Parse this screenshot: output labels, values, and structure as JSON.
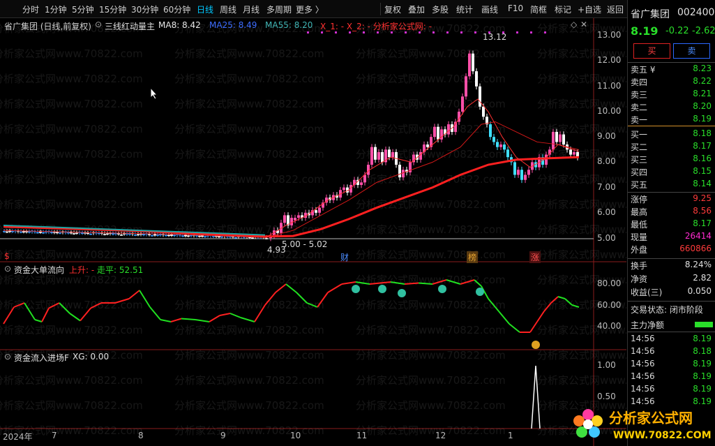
{
  "toolbar": {
    "periods": [
      "分时",
      "1分钟",
      "5分钟",
      "15分钟",
      "30分钟",
      "60分钟",
      "日线",
      "周线",
      "月线",
      "多周期",
      "更多 〉"
    ],
    "active": "日线",
    "tools": [
      "复权",
      "叠加",
      "多股",
      "统计",
      "画线",
      "F10",
      "简框",
      "标记",
      "+自选",
      "返回"
    ]
  },
  "main_chart": {
    "title": "省广集团 (日线,前复权)",
    "indicator": "三线红动量主",
    "ma8": "MA8: 8.42",
    "ma25": "MA25: 8.49",
    "ma55": "MA55: 8.20",
    "x_items": "X_1: -  X_2: -  分析家公式网: -",
    "high_label": "13.12",
    "low_label": "4.93",
    "range_label": "5.00 - 5.02",
    "markers": [
      "$",
      "财",
      "榜",
      "涨"
    ],
    "y_ticks": [
      "13.00",
      "12.00",
      "11.00",
      "10.00",
      "9.00",
      "8.00",
      "7.00",
      "6.00",
      "5.00"
    ]
  },
  "sub1": {
    "title": "资金大单流向",
    "up_label": "上升: -",
    "flat_label": "走平: 52.51",
    "y_ticks": [
      "80.00",
      "60.00",
      "40.00"
    ]
  },
  "sub2": {
    "title": "资金流入进场F",
    "xg": "XG: 0.00",
    "y_ticks": [
      "1.00",
      "0.50"
    ]
  },
  "x_axis": [
    "2024年",
    "7",
    "8",
    "9",
    "10",
    "11",
    "12",
    "1"
  ],
  "watermark": "分析家公式网www.70822.com",
  "right_panel": {
    "name": "省广集团",
    "code": "002400",
    "price": "8.19",
    "change": "-0.22",
    "pct": "-2.62",
    "buy_btn": "买",
    "sell_btn": "卖",
    "asks": [
      {
        "label": "卖五 ¥",
        "value": "8.23"
      },
      {
        "label": "卖四",
        "value": "8.22"
      },
      {
        "label": "卖三",
        "value": "8.21"
      },
      {
        "label": "卖二",
        "value": "8.20"
      },
      {
        "label": "卖一",
        "value": "8.19"
      }
    ],
    "bids": [
      {
        "label": "买一",
        "value": "8.18"
      },
      {
        "label": "买二",
        "value": "8.17"
      },
      {
        "label": "买三",
        "value": "8.16"
      },
      {
        "label": "买四",
        "value": "8.15"
      },
      {
        "label": "买五",
        "value": "8.14"
      }
    ],
    "stats": [
      {
        "label": "涨停",
        "value": "9.25"
      },
      {
        "label": "最高",
        "value": "8.56"
      },
      {
        "label": "最低",
        "value": "8.17"
      },
      {
        "label": "现量",
        "value": "26414"
      },
      {
        "label": "外盘",
        "value": "660866"
      }
    ],
    "stats2": [
      {
        "label": "换手",
        "value": "8.24%"
      },
      {
        "label": "净资",
        "value": "2.82"
      },
      {
        "label": "收益(三)",
        "value": "0.050"
      }
    ],
    "trade_status": "交易状态: 闭市阶段",
    "main_net": "主力净额",
    "ticks": [
      {
        "time": "14:56",
        "price": "8.19"
      },
      {
        "time": "14:56",
        "price": "8.18"
      },
      {
        "time": "14:56",
        "price": "8.19"
      },
      {
        "time": "14:56",
        "price": "8.19"
      },
      {
        "time": "14:56",
        "price": "8.19"
      },
      {
        "time": "14:56",
        "price": "8.19"
      }
    ]
  },
  "logo_text": "分析家公式网",
  "logo_url": "WWW.70822.COM"
}
